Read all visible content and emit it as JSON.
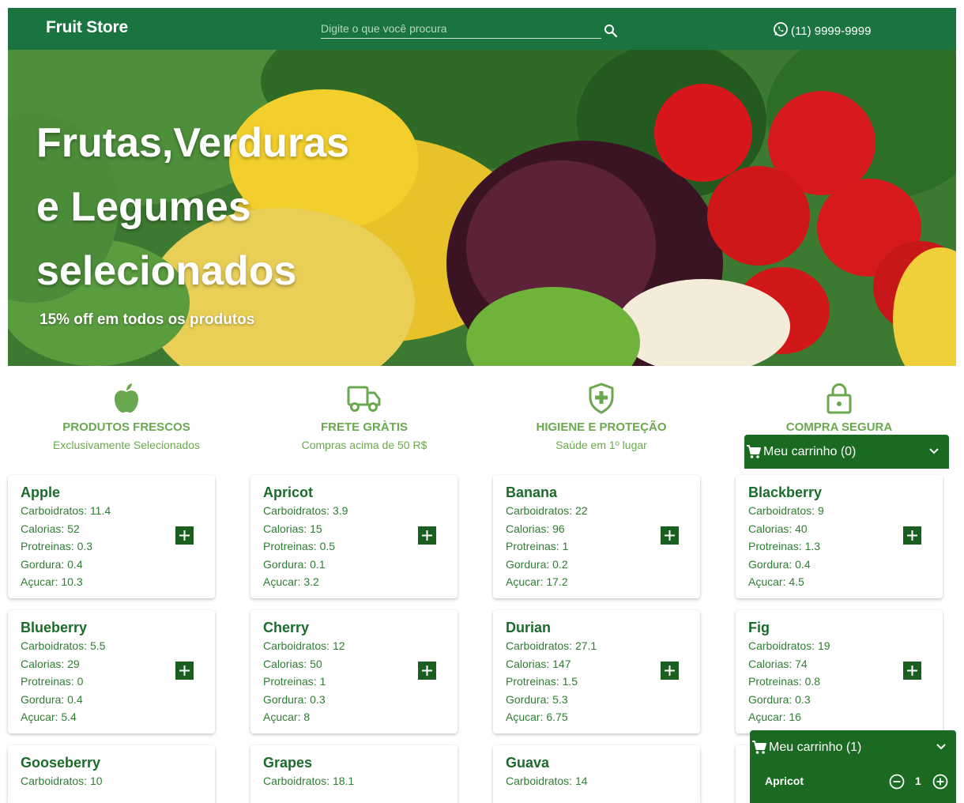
{
  "header": {
    "brand": "Fruit Store",
    "search_placeholder": "Digite o que você procura",
    "phone": "(11) 9999-9999"
  },
  "hero": {
    "title_line1": "Frutas,Verduras",
    "title_line2": "e Legumes",
    "title_line3": "selecionados",
    "subtitle": "15% off em todos os produtos"
  },
  "features": [
    {
      "icon": "apple-icon",
      "title": "PRODUTOS FRESCOS",
      "subtitle": "Exclusivamente Selecionados"
    },
    {
      "icon": "truck-icon",
      "title": "FRETE GRÀTIS",
      "subtitle": "Compras acima de 50 R$"
    },
    {
      "icon": "shield-plus-icon",
      "title": "HIGIENE E PROTEÇÃO",
      "subtitle": "Saúde em 1º lugar"
    },
    {
      "icon": "lock-icon",
      "title": "COMPRA SEGURA",
      "subtitle": ""
    }
  ],
  "labels": {
    "carbs": "Carboidratos: ",
    "calories": "Calorias: ",
    "protein": "Protreinas: ",
    "fat": "Gordura: ",
    "sugar": "Açucar: "
  },
  "products": [
    {
      "name": "Apple",
      "carbs": "11.4",
      "calories": "52",
      "protein": "0.3",
      "fat": "0.4",
      "sugar": "10.3"
    },
    {
      "name": "Apricot",
      "carbs": "3.9",
      "calories": "15",
      "protein": "0.5",
      "fat": "0.1",
      "sugar": "3.2"
    },
    {
      "name": "Banana",
      "carbs": "22",
      "calories": "96",
      "protein": "1",
      "fat": "0.2",
      "sugar": "17.2"
    },
    {
      "name": "Blackberry",
      "carbs": "9",
      "calories": "40",
      "protein": "1.3",
      "fat": "0.4",
      "sugar": "4.5"
    },
    {
      "name": "Blueberry",
      "carbs": "5.5",
      "calories": "29",
      "protein": "0",
      "fat": "0.4",
      "sugar": "5.4"
    },
    {
      "name": "Cherry",
      "carbs": "12",
      "calories": "50",
      "protein": "1",
      "fat": "0.3",
      "sugar": "8"
    },
    {
      "name": "Durian",
      "carbs": "27.1",
      "calories": "147",
      "protein": "1.5",
      "fat": "5.3",
      "sugar": "6.75"
    },
    {
      "name": "Fig",
      "carbs": "19",
      "calories": "74",
      "protein": "0.8",
      "fat": "0.3",
      "sugar": "16"
    },
    {
      "name": "Gooseberry",
      "carbs": "10"
    },
    {
      "name": "Grapes",
      "carbs": "18.1"
    },
    {
      "name": "Guava",
      "carbs": "14"
    }
  ],
  "cart_small": {
    "label": "Meu carrinho (0)"
  },
  "cart_big": {
    "label": "Meu carrinho (1)",
    "item_name": "Apricot",
    "quantity": "1"
  },
  "colors": {
    "header_bg": "#1a7440",
    "accent": "#6aa84f",
    "cart_bg": "#1a6a22",
    "text_green": "#1b6b2a"
  }
}
